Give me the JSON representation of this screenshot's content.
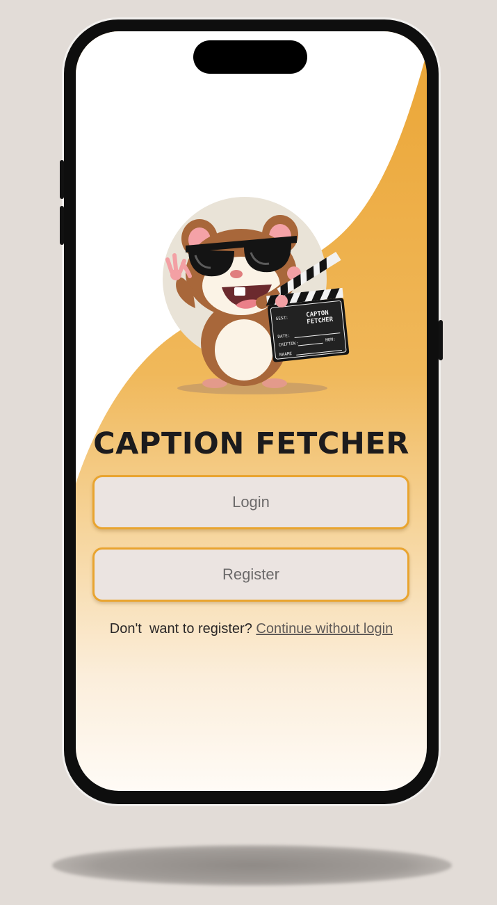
{
  "app": {
    "title": "CAPTION FETCHER"
  },
  "buttons": {
    "login_label": "Login",
    "register_label": "Register"
  },
  "guest": {
    "prompt_text": "Don't  want to register? ",
    "link_label": "Continue without login"
  },
  "mascot": {
    "description_icon": "hamster-mascot-with-clapperboard",
    "clapper_line1": "CAPTON",
    "clapper_line2": "FETCHER",
    "clapper_field_scene": "GESZ:",
    "clapper_field_date": "DATE:",
    "clapper_field_shot": "CHIFTOK:",
    "clapper_field_name": "NAAME",
    "clapper_field_mom": "MOM:"
  },
  "colors": {
    "accent": "#e9a42f",
    "button_bg": "#ebe4e1",
    "title": "#1c1b1d",
    "page_bg": "#e2dcd7"
  }
}
